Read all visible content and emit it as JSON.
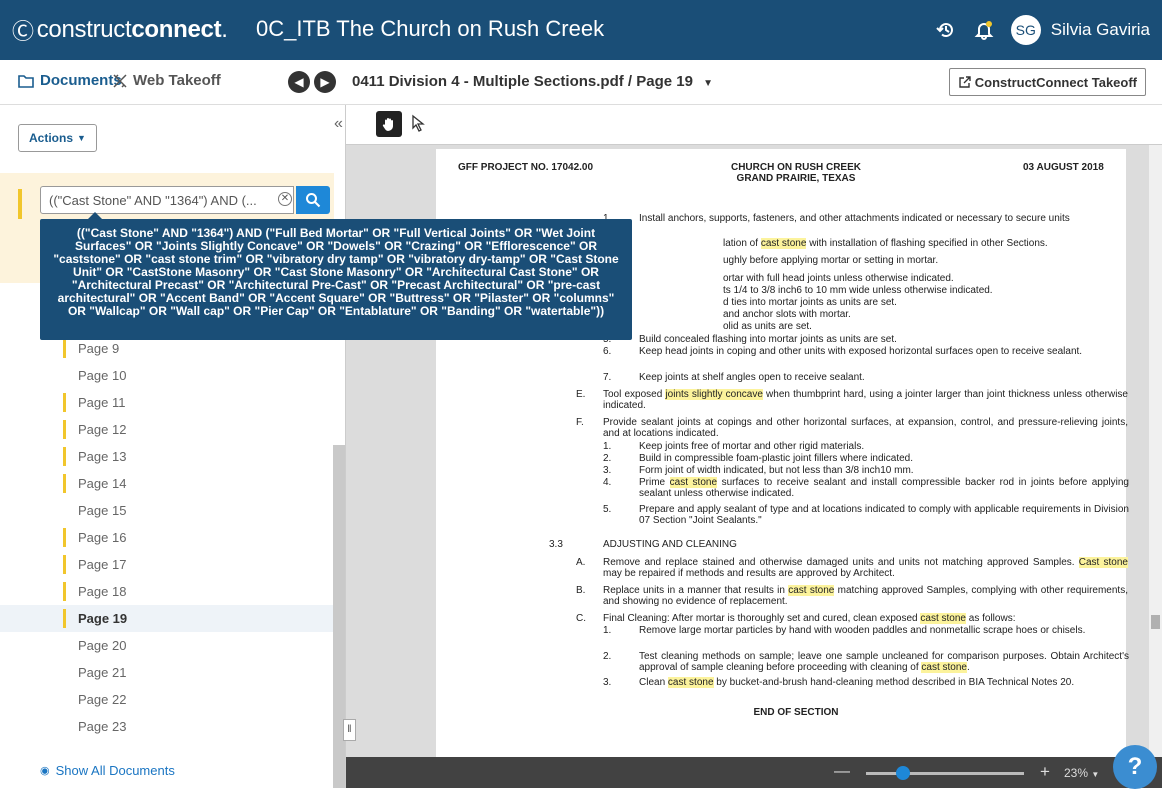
{
  "header": {
    "logo_prefix": "construct",
    "logo_bold": "connect",
    "logo_suffix": ".",
    "project_title": "0C_ITB The Church on Rush Creek",
    "user_initials": "SG",
    "user_name": "Silvia Gaviria"
  },
  "toolbar": {
    "tab_documents": "Documents",
    "tab_web_takeoff": "Web Takeoff",
    "filename": "0411 Division 4 - Multiple Sections.pdf / Page 19",
    "cc_takeoff": "ConstructConnect Takeoff"
  },
  "sidebar": {
    "actions_label": "Actions",
    "search_value": "((\"Cast Stone\" AND \"1364\") AND (...",
    "tooltip": "((\"Cast Stone\" AND \"1364\") AND (\"Full Bed Mortar\" OR \"Full Vertical Joints\" OR \"Wet Joint Surfaces\" OR \"Joints Slightly Concave\" OR \"Dowels\" OR \"Crazing\" OR \"Efflorescence\" OR \"caststone\" OR \"cast stone trim\" OR \"vibratory dry tamp\" OR \"vibratory dry-tamp\" OR \"Cast Stone Unit\" OR \"CastStone Masonry\" OR \"Cast Stone Masonry\" OR \"Architectural Cast Stone\" OR \"Architectural Precast\" OR \"Architectural Pre-Cast\" OR \"Precast Architectural\" OR \"pre-cast architectural\" OR \"Accent Band\" OR \"Accent Square\" OR \"Buttress\" OR \"Pilaster\" OR \"columns\" OR \"Wallcap\" OR \"Wall cap\" OR \"Pier Cap\" OR \"Entablature\" OR \"Banding\" OR \"watertable\"))",
    "pages": [
      {
        "label": "Page 9",
        "hit": true,
        "active": false
      },
      {
        "label": "Page 10",
        "hit": false,
        "active": false
      },
      {
        "label": "Page 11",
        "hit": true,
        "active": false
      },
      {
        "label": "Page 12",
        "hit": true,
        "active": false
      },
      {
        "label": "Page 13",
        "hit": true,
        "active": false
      },
      {
        "label": "Page 14",
        "hit": true,
        "active": false
      },
      {
        "label": "Page 15",
        "hit": false,
        "active": false
      },
      {
        "label": "Page 16",
        "hit": true,
        "active": false
      },
      {
        "label": "Page 17",
        "hit": true,
        "active": false
      },
      {
        "label": "Page 18",
        "hit": true,
        "active": false
      },
      {
        "label": "Page 19",
        "hit": true,
        "active": true
      },
      {
        "label": "Page 20",
        "hit": false,
        "active": false
      },
      {
        "label": "Page 21",
        "hit": false,
        "active": false
      },
      {
        "label": "Page 22",
        "hit": false,
        "active": false
      },
      {
        "label": "Page 23",
        "hit": false,
        "active": false
      }
    ],
    "show_all": "Show All Documents"
  },
  "viewer": {
    "zoom": "23%",
    "zoom_fraction": 0.2,
    "help": "?"
  },
  "document": {
    "hdr_project": "GFF PROJECT NO. 17042.00",
    "hdr_title1": "CHURCH ON RUSH CREEK",
    "hdr_title2": "GRAND PRAIRIE, TEXAS",
    "hdr_date": "03 AUGUST 2018",
    "l1": "Install anchors, supports, fasteners, and other attachments indicated or necessary to secure units",
    "l2a": "lation of",
    "l2b": "cast stone",
    "l2c": "with installation of flashing specified in other Sections.",
    "l3": "ughly before applying mortar or setting in mortar.",
    "l4": "ortar with full head joints unless otherwise indicated.",
    "l5": "ts 1/4 to 3/8 inch6 to 10 mm wide unless otherwise indicated.",
    "l6": "d ties into mortar joints as units are set.",
    "l7": "and anchor slots with mortar.",
    "l8": "olid as units are set.",
    "n5": "5.",
    "t5": "Build concealed flashing into mortar joints as units are set.",
    "n6": "6.",
    "t6": "Keep head joints in coping and other units with exposed horizontal surfaces open to receive sealant.",
    "n7": "7.",
    "t7": "Keep joints at shelf angles open to receive sealant.",
    "eL": "E.",
    "e1": "Tool exposed",
    "e2": "joints slightly concave",
    "e3": "when thumbprint hard, using a jointer larger than joint thickness unless otherwise indicated.",
    "fL": "F.",
    "f": "Provide sealant joints at copings and other horizontal surfaces, at expansion, control, and pressure-relieving joints, and at locations indicated.",
    "f1": "Keep joints free of mortar and other rigid materials.",
    "f2": "Build in compressible foam-plastic joint fillers where indicated.",
    "f3": "Form joint of width indicated, but not less than 3/8 inch10 mm.",
    "f4a": "Prime",
    "f4b": "cast stone",
    "f4c": "surfaces to receive sealant and install compressible backer rod in joints before applying sealant unless otherwise indicated.",
    "f5": "Prepare and apply sealant of type and at locations indicated to comply with applicable requirements in Division 07 Section \"Joint Sealants.\"",
    "s33n": "3.3",
    "s33": "ADJUSTING AND CLEANING",
    "aL": "A.",
    "a1": "Remove and replace stained and otherwise damaged units and units not matching approved Samples.",
    "a2": "Cast stone",
    "a3": "may be repaired if methods and results are approved by Architect.",
    "bL": "B.",
    "b1": "Replace units in a manner that results in",
    "b2": "cast stone",
    "b3": "matching approved Samples, complying with other requirements, and showing no evidence of replacement.",
    "cL": "C.",
    "c1": "Final Cleaning: After mortar is thoroughly set and cured, clean exposed",
    "c2": "cast stone",
    "c3": "as follows:",
    "cc1": "Remove large mortar particles by hand with wooden paddles and nonmetallic scrape hoes or chisels.",
    "cc2a": "Test cleaning methods on sample; leave one sample uncleaned for comparison purposes. Obtain Architect's approval of sample cleaning before proceeding with cleaning of",
    "cc2b": "cast stone",
    "cc2c": ".",
    "cc3a": "Clean",
    "cc3b": "cast stone",
    "cc3c": "by bucket-and-brush hand-cleaning method described in BIA Technical Notes 20.",
    "end": "END OF SECTION",
    "num1": "1.",
    "num2": "2.",
    "num3": "3.",
    "num4": "4.",
    "num5": "5."
  }
}
